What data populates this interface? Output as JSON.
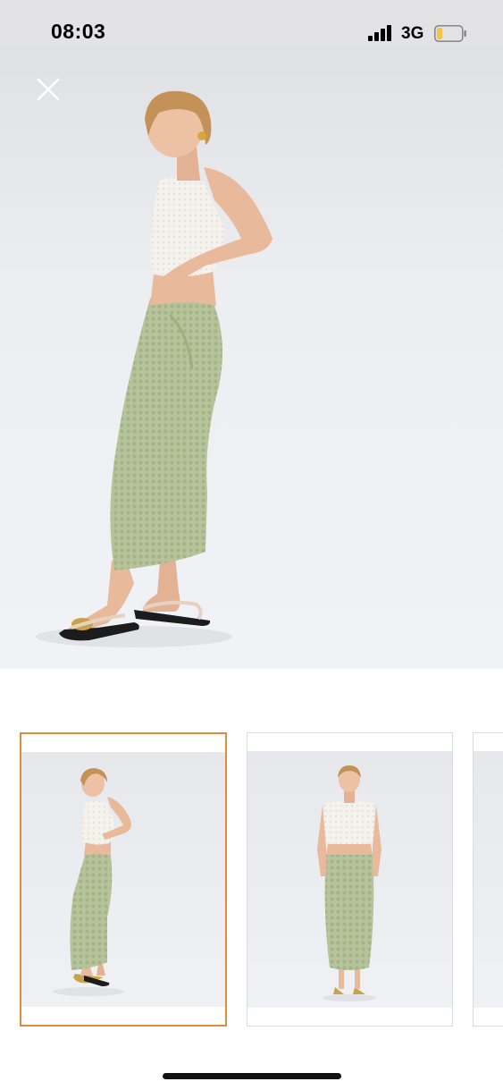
{
  "status_bar": {
    "time": "08:03",
    "network": "3G",
    "battery_level": 0.2,
    "battery_color": "#f5c542"
  },
  "gallery": {
    "close_icon": "close-icon",
    "selected_index": 0,
    "accent_color": "#e08c3e",
    "thumbnails": [
      {
        "pose": "side-view"
      },
      {
        "pose": "front-view"
      },
      {
        "pose": "partial"
      }
    ]
  },
  "product_colors": {
    "skirt": "#b7c49b",
    "top": "#f4f2ec",
    "skin": "#e8b99a",
    "hair": "#c49257"
  }
}
